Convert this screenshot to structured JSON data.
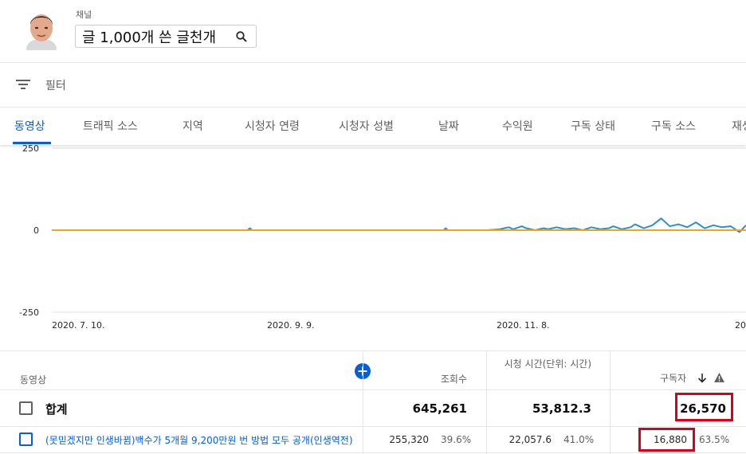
{
  "header": {
    "channel_label": "채널",
    "channel_name": "글 1,000개 쓴 글천개"
  },
  "filter": {
    "label": "필터"
  },
  "tabs": [
    {
      "label": "동영상",
      "active": true
    },
    {
      "label": "트래픽 소스"
    },
    {
      "label": "지역"
    },
    {
      "label": "시청자 연령"
    },
    {
      "label": "시청자 성별"
    },
    {
      "label": "날짜"
    },
    {
      "label": "수익원"
    },
    {
      "label": "구독 상태"
    },
    {
      "label": "구독 소스"
    },
    {
      "label": "재생"
    }
  ],
  "colors": {
    "accent": "#065fd4",
    "highlight": "#d9001b",
    "series_total": "#f2a51c",
    "series_video": "#2e8fcf"
  },
  "chart_data": {
    "type": "line",
    "ylim": [
      -250,
      250
    ],
    "y_ticks": [
      "250",
      "0",
      "-250"
    ],
    "x_ticks": [
      "2020. 7. 10.",
      "2020. 9. 9.",
      "2020. 11. 8.",
      "20"
    ],
    "series": [
      {
        "color": "#f2a51c",
        "x": [
          0,
          100,
          200,
          300,
          319
        ],
        "values": [
          0,
          0,
          0,
          0,
          0
        ]
      },
      {
        "color": "#2e8fcf",
        "x": [
          0,
          90,
          91,
          92,
          180,
          181,
          182,
          200,
          206,
          208,
          210,
          212,
          216,
          218,
          222,
          226,
          228,
          232,
          236,
          240,
          244,
          248,
          252,
          256,
          258,
          262,
          266,
          268,
          272,
          276,
          280,
          284,
          288,
          292,
          296,
          300,
          304,
          308,
          312,
          316,
          319
        ],
        "values": [
          0,
          0,
          2,
          0,
          0,
          2,
          0,
          0,
          1,
          2,
          3,
          1,
          4,
          2,
          0,
          2,
          1,
          3,
          1,
          2,
          0,
          3,
          1,
          2,
          4,
          1,
          3,
          6,
          2,
          5,
          12,
          4,
          6,
          3,
          8,
          2,
          5,
          3,
          4,
          -2,
          5
        ]
      }
    ]
  },
  "table": {
    "headers": {
      "video": "동영상",
      "views": "조회수",
      "watch_time": "시청 시간(단위: 시간)",
      "subscribers": "구독자"
    },
    "total": {
      "label": "합계",
      "views": "645,261",
      "watch_time": "53,812.3",
      "subscribers": "26,570"
    },
    "rows": [
      {
        "title": "(못믿겠지만 인생바뀜)백수가 5개월 9,200만원 번 방법 모두 공개(인생역전)",
        "views": "255,320",
        "views_pct": "39.6%",
        "watch_time": "22,057.6",
        "watch_time_pct": "41.0%",
        "subscribers": "16,880",
        "subscribers_pct": "63.5%"
      }
    ]
  }
}
